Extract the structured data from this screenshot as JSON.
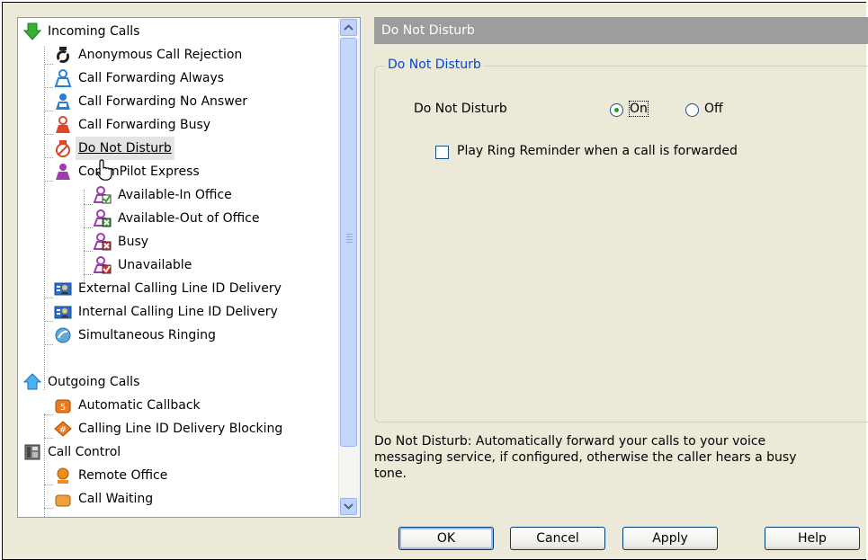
{
  "tree": {
    "items": [
      {
        "label": "Incoming Calls",
        "icon": "incoming-calls-icon"
      },
      {
        "label": "Anonymous Call Rejection",
        "icon": "anonymous-rejection-icon"
      },
      {
        "label": "Call Forwarding Always",
        "icon": "forward-always-icon"
      },
      {
        "label": "Call Forwarding No Answer",
        "icon": "forward-no-answer-icon"
      },
      {
        "label": "Call Forwarding Busy",
        "icon": "forward-busy-icon"
      },
      {
        "label": "Do Not Disturb",
        "icon": "do-not-disturb-icon"
      },
      {
        "label": "CommPilot Express",
        "icon": "commpilot-express-icon"
      },
      {
        "label": "Available-In Office",
        "icon": "available-in-office-icon"
      },
      {
        "label": "Available-Out of Office",
        "icon": "available-out-office-icon"
      },
      {
        "label": "Busy",
        "icon": "busy-icon"
      },
      {
        "label": "Unavailable",
        "icon": "unavailable-icon"
      },
      {
        "label": "External Calling Line ID Delivery",
        "icon": "external-clid-icon"
      },
      {
        "label": "Internal Calling Line ID Delivery",
        "icon": "internal-clid-icon"
      },
      {
        "label": "Simultaneous Ringing",
        "icon": "simultaneous-ringing-icon"
      },
      {
        "label": "Outgoing Calls",
        "icon": "outgoing-calls-icon"
      },
      {
        "label": "Automatic Callback",
        "icon": "automatic-callback-icon"
      },
      {
        "label": "Calling Line ID Delivery Blocking",
        "icon": "clid-blocking-icon"
      },
      {
        "label": "Call Control",
        "icon": "call-control-icon"
      },
      {
        "label": "Remote Office",
        "icon": "remote-office-icon"
      },
      {
        "label": "Call Waiting",
        "icon": "call-waiting-icon"
      }
    ],
    "selected": "Do Not Disturb"
  },
  "panel": {
    "header": "Do Not Disturb",
    "group_title": "Do Not Disturb",
    "dnd_label": "Do Not Disturb",
    "on_label": "On",
    "off_label": "Off",
    "selected": "On",
    "ring_reminder_label": "Play Ring Reminder when a call is forwarded",
    "ring_reminder_checked": false,
    "description": "Do Not Disturb: Automatically forward your calls to your voice messaging service, if configured, otherwise the caller hears a busy tone."
  },
  "buttons": {
    "ok": "OK",
    "cancel": "Cancel",
    "apply": "Apply",
    "help": "Help"
  },
  "colors": {
    "header_bg": "#9d9d9d",
    "legend_text": "#0046d5",
    "window_bg": "#ece9d8"
  }
}
